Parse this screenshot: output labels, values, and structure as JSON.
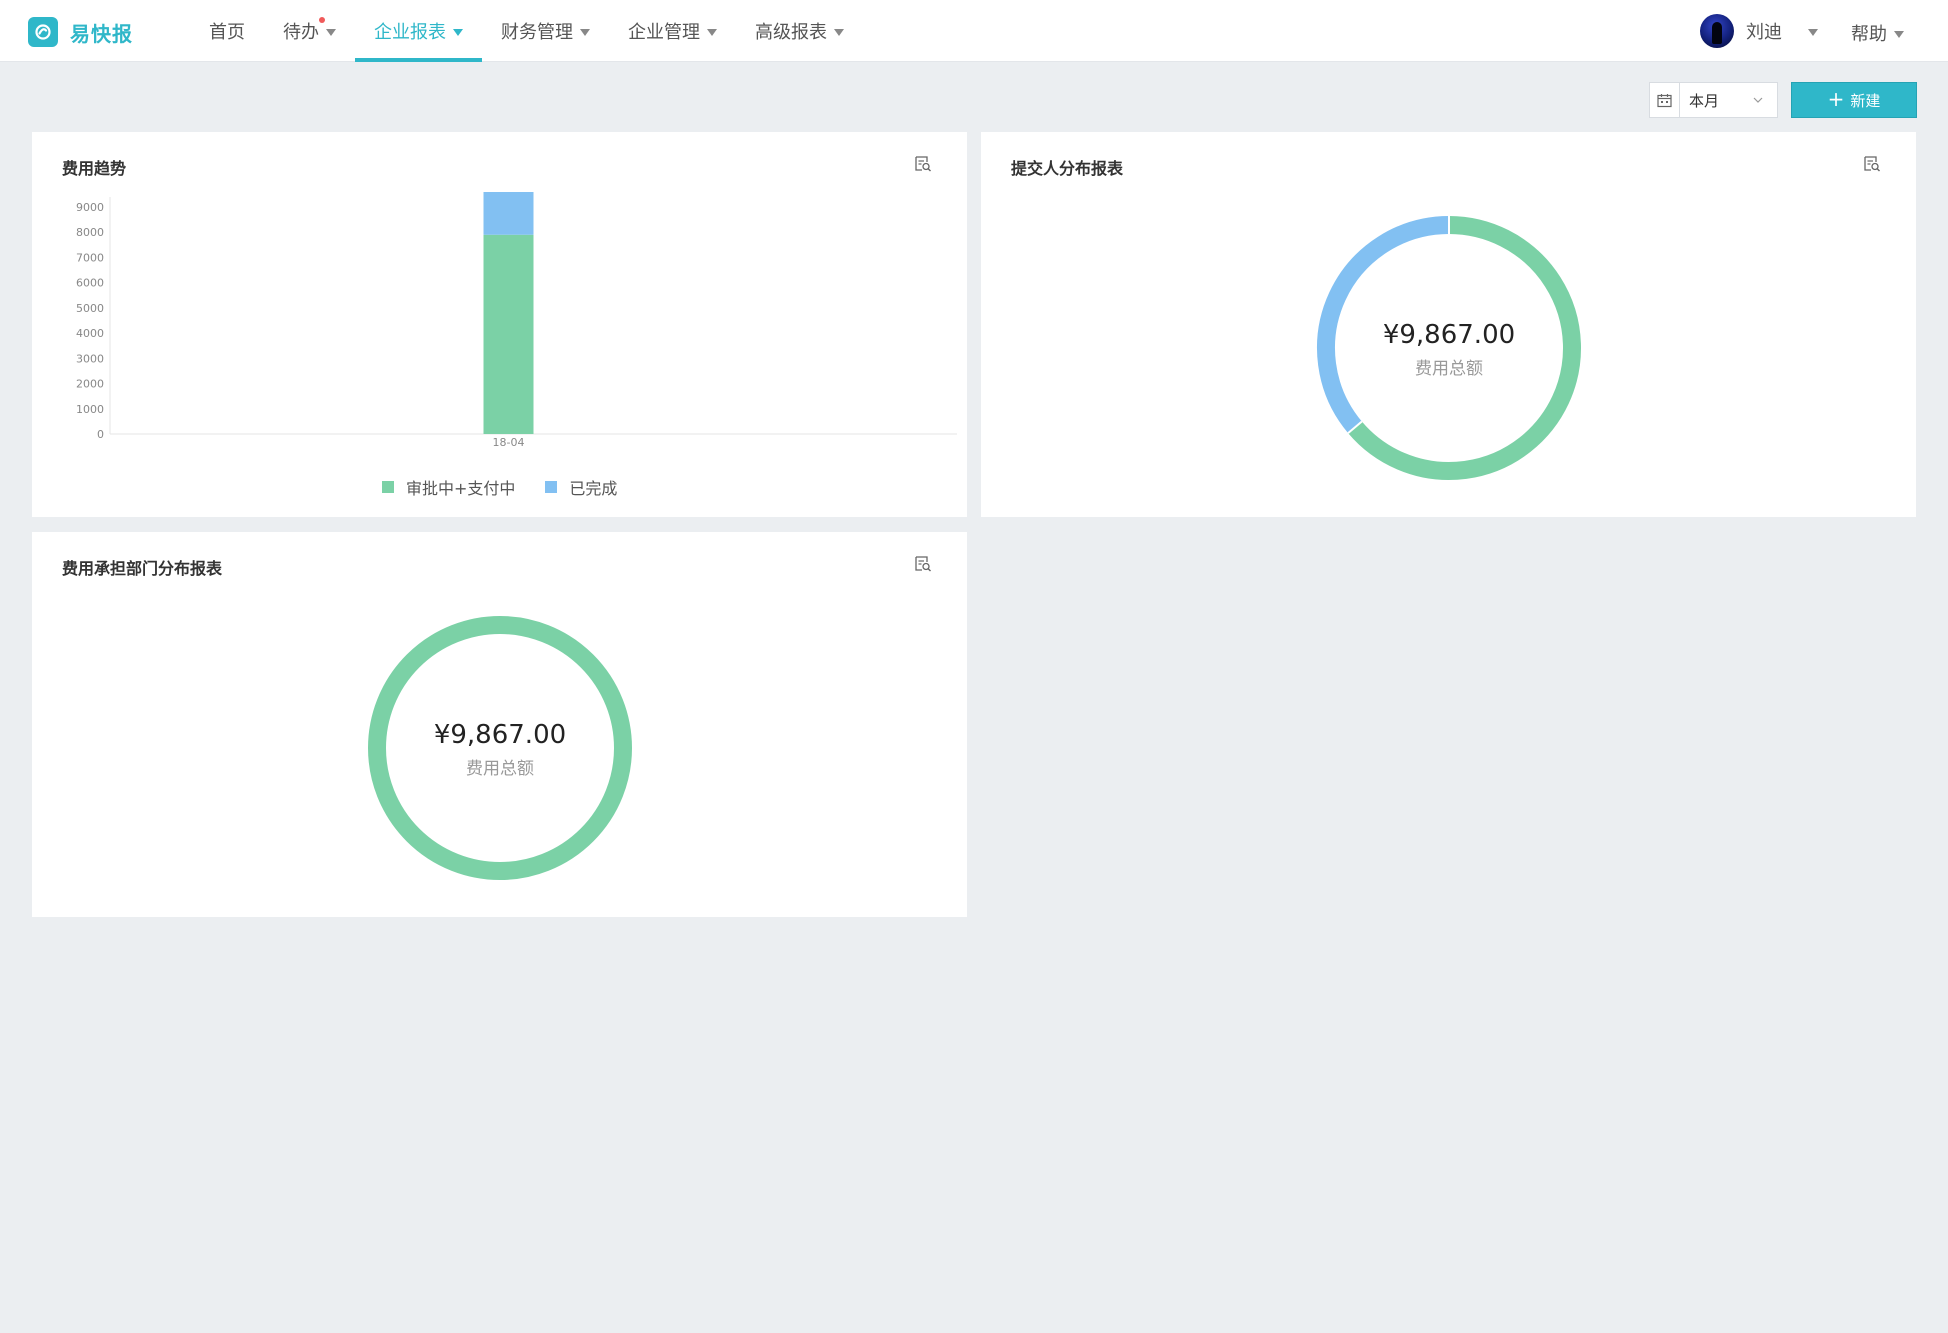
{
  "app": {
    "name": "易快报"
  },
  "nav": {
    "items": [
      {
        "label": "首页",
        "active": false,
        "has_caret": false,
        "has_dot": false
      },
      {
        "label": "待办",
        "active": false,
        "has_caret": true,
        "has_dot": true
      },
      {
        "label": "企业报表",
        "active": true,
        "has_caret": true,
        "has_dot": false
      },
      {
        "label": "财务管理",
        "active": false,
        "has_caret": true,
        "has_dot": false
      },
      {
        "label": "企业管理",
        "active": false,
        "has_caret": true,
        "has_dot": false
      },
      {
        "label": "高级报表",
        "active": false,
        "has_caret": true,
        "has_dot": false
      }
    ]
  },
  "user": {
    "name": "刘迪"
  },
  "help": {
    "label": "帮助"
  },
  "toolbar": {
    "date_value": "本月",
    "new_label": "新建"
  },
  "colors": {
    "accent": "#2fb7c9",
    "green": "#7bd1a6",
    "blue": "#82c0f2"
  },
  "cards": {
    "trend": {
      "title": "费用趋势"
    },
    "submitter": {
      "title": "提交人分布报表",
      "amount": "¥9,867.00",
      "caption": "费用总额"
    },
    "department": {
      "title": "费用承担部门分布报表",
      "amount": "¥9,867.00",
      "caption": "费用总额"
    }
  },
  "chart_data": [
    {
      "type": "bar",
      "stacked": true,
      "title": "费用趋势",
      "categories": [
        "18-04"
      ],
      "series": [
        {
          "name": "审批中+支付中",
          "values": [
            7900
          ],
          "color": "#7bd1a6"
        },
        {
          "name": "已完成",
          "values": [
            1967
          ],
          "color": "#82c0f2"
        }
      ],
      "yticks": [
        0,
        1000,
        2000,
        3000,
        4000,
        5000,
        6000,
        7000,
        8000,
        9000
      ],
      "ylim": [
        0,
        9000
      ],
      "legend": "bottom-center",
      "grid": false
    },
    {
      "type": "pie",
      "donut": true,
      "title": "提交人分布报表",
      "slices": [
        {
          "value": 6300,
          "color": "#7bd1a6"
        },
        {
          "value": 3567,
          "color": "#82c0f2"
        }
      ],
      "total_label": "¥9,867.00",
      "caption": "费用总额"
    },
    {
      "type": "pie",
      "donut": true,
      "title": "费用承担部门分布报表",
      "slices": [
        {
          "value": 9867,
          "color": "#7bd1a6"
        }
      ],
      "total_label": "¥9,867.00",
      "caption": "费用总额"
    }
  ]
}
